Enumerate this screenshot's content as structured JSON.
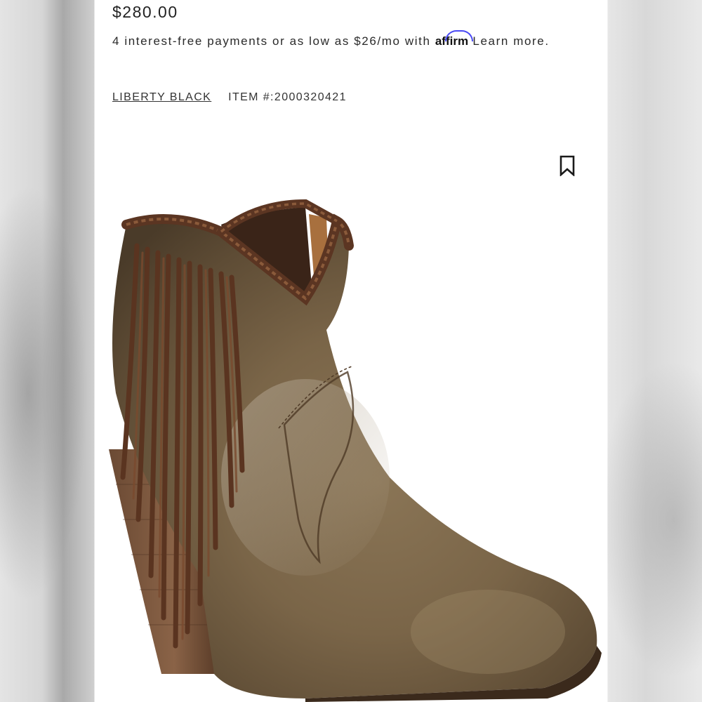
{
  "product": {
    "price": "$280.00",
    "payment_text": "4 interest-free payments or as low as $26/mo with",
    "affirm_logo": "affirm",
    "learn_more": "Learn more.",
    "brand": "LIBERTY BLACK",
    "item_number": "ITEM #:2000320421"
  },
  "icons": {
    "bookmark": "bookmark-icon"
  },
  "colors": {
    "affirm_accent": "#4a4af4",
    "text": "#2a2a2a",
    "boot_leather": "#7a6548",
    "fringe": "#5a3420"
  }
}
